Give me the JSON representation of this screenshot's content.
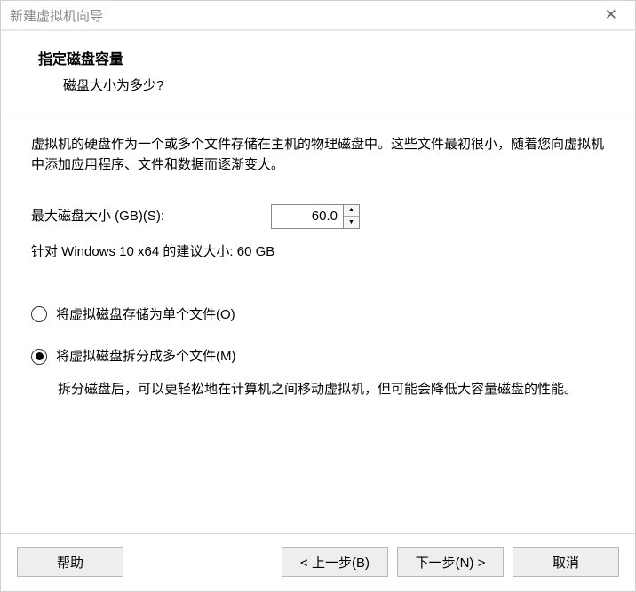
{
  "window": {
    "title": "新建虚拟机向导"
  },
  "header": {
    "title": "指定磁盘容量",
    "subtitle": "磁盘大小为多少?"
  },
  "content": {
    "description": "虚拟机的硬盘作为一个或多个文件存储在主机的物理磁盘中。这些文件最初很小，随着您向虚拟机中添加应用程序、文件和数据而逐渐变大。",
    "size_label": "最大磁盘大小 (GB)(S):",
    "size_value": "60.0",
    "recommend_text": "针对 Windows 10 x64 的建议大小: 60 GB",
    "radio_single": "将虚拟磁盘存储为单个文件(O)",
    "radio_split": "将虚拟磁盘拆分成多个文件(M)",
    "split_desc": "拆分磁盘后，可以更轻松地在计算机之间移动虚拟机，但可能会降低大容量磁盘的性能。",
    "selected": "split"
  },
  "footer": {
    "help": "帮助",
    "back": "< 上一步(B)",
    "next": "下一步(N) >",
    "cancel": "取消"
  }
}
